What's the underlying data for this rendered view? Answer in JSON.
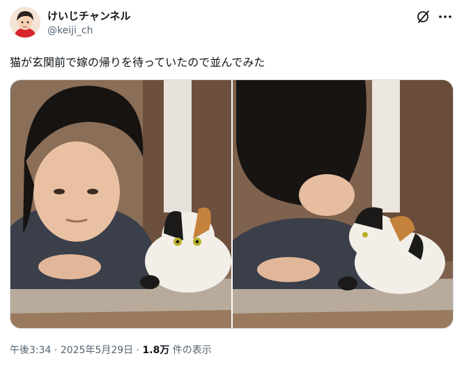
{
  "author": {
    "display_name": "けいじチャンネル",
    "handle": "@keiji_ch"
  },
  "icons": {
    "grok": "grok-icon",
    "more": "more-icon"
  },
  "tweet": {
    "text": "猫が玄関前で嫁の帰りを待っていたので並んでみた"
  },
  "meta": {
    "time": "午後3:34",
    "separator_1": " · ",
    "date": "2025年5月29日",
    "separator_2": " · ",
    "views_count": "1.8万",
    "views_label": " 件の表示"
  },
  "colors": {
    "text_primary": "#0f1419",
    "text_secondary": "#536471",
    "border": "#cfd9de"
  }
}
